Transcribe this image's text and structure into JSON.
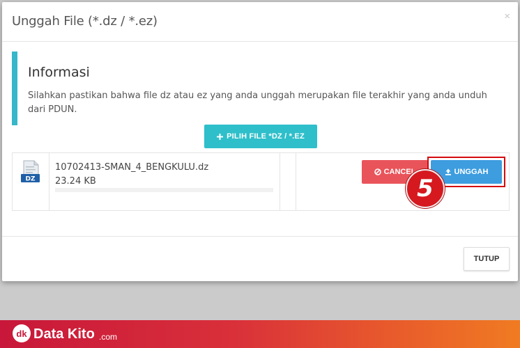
{
  "dialog": {
    "title": "Unggah File (*.dz / *.ez)",
    "close_symbol": "×"
  },
  "info": {
    "title": "Informasi",
    "text": "Silahkan pastikan bahwa file dz atau ez yang anda unggah merupakan file terakhir yang anda unduh dari PDUN."
  },
  "actions": {
    "choose_file_label": "PILIH FILE *DZ / *.EZ",
    "close_label": "TUTUP"
  },
  "file": {
    "icon": "dz-file-icon",
    "icon_text": "DZ",
    "name": "10702413-SMAN_4_BENGKULU.dz",
    "size": "23.24 KB",
    "progress": 0,
    "cancel_label": "CANCEL",
    "upload_label": "UNGGAH"
  },
  "annotation": {
    "step": "5"
  },
  "branding": {
    "logo_text": "dk",
    "name": "Data Kito",
    "tld": ".com"
  },
  "colors": {
    "accent_info": "#37b7c9",
    "choose_button": "#2ebfca",
    "cancel_button": "#e9545a",
    "upload_button": "#3d9ddf",
    "highlight": "#d40a10"
  }
}
